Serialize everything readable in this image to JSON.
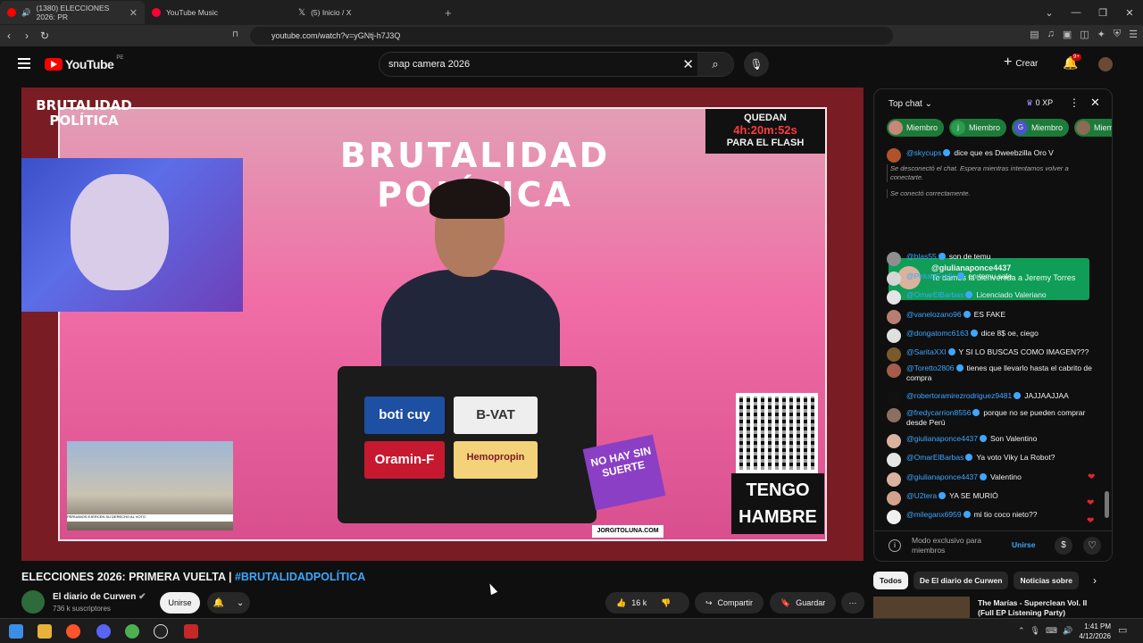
{
  "browser": {
    "tabs": [
      {
        "label": "(1380) ELECCIONES 2026: PR",
        "color": "#ff0000"
      },
      {
        "label": "YouTube Music",
        "color": "#ff0033"
      },
      {
        "label": "(5) Inicio / X",
        "color": "#ffffff"
      }
    ],
    "url": "youtube.com/watch?v=yGNtj-h7J3Q"
  },
  "header": {
    "brand": "YouTube",
    "country_code": "PE",
    "search_value": "snap camera 2026",
    "create_label": "Crear",
    "notif_badge": "9+"
  },
  "video": {
    "headline": "BRUTALIDAD POLÍTICA",
    "logo_text": "BRUTALIDAD POLÍTICA",
    "timer_top": "QUEDAN",
    "timer_value": "4h:20m:52s",
    "timer_bottom": "PARA EL FLASH",
    "stickers": [
      "boti cuy",
      "B-VAT",
      "Oramin-F",
      "Hemopropin"
    ],
    "nohay": "NO HAY SIN SUERTE",
    "tengo": "TENGO HAMBRE",
    "handle": "JORGITOLUNA.COM",
    "inset_caption": "PERUANOS EJERCEN SU DERECHO AL VOTO"
  },
  "info": {
    "title": "ELECCIONES 2026: PRIMERA VUELTA | ",
    "hashtag": "#BRUTALIDADPOLÍTICA",
    "channel": "El diario de Curwen",
    "subscribers": "736 k suscriptores",
    "join": "Unirse",
    "likes": "16 k",
    "share": "Compartir",
    "save": "Guardar"
  },
  "chat": {
    "mode": "Top chat",
    "xp": "0 XP",
    "member_label": "Miembro",
    "member_pills": [
      {
        "initial": "",
        "color": "#c8877a"
      },
      {
        "initial": "j",
        "color": "#2b9b4f"
      },
      {
        "initial": "G",
        "color": "#4a55c8"
      },
      {
        "initial": "",
        "color": "#8a6b55"
      }
    ],
    "messages": [
      {
        "user": "@skycups",
        "text": "dice que es Dweebzilla Oro V",
        "color": "#b0532d"
      },
      {
        "user": "@blas55",
        "text": "son de temu",
        "color": "#8f8f8f"
      },
      {
        "user": "@PirkaqGrafic",
        "text": "en temu sale",
        "color": "#d6d6d6"
      },
      {
        "user": "@OmarElBarbas",
        "text": "Licenciado Valeriano",
        "color": "#e5e5e5"
      },
      {
        "user": "@vanelozano96",
        "text": "ES FAKE",
        "color": "#b77e72"
      },
      {
        "user": "@dongatomc6163",
        "text": "dice 8$ oe, ciego",
        "color": "#e0e0e0"
      },
      {
        "user": "@SaritaXXI",
        "text": "Y SI LO BUSCAS COMO IMAGEN???",
        "color": "#7a5a2a"
      },
      {
        "user": "@Toretto2806",
        "text": "tienes que llevarlo hasta el cabrito de compra",
        "color": "#a65b4b"
      },
      {
        "user": "@robertoramirezrodriguez9481",
        "text": "JAJJAAJJAA",
        "color": "#111111"
      },
      {
        "user": "@fredycarrion8556",
        "text": "porque no se pueden comprar desde Perú",
        "color": "#8d6e63"
      },
      {
        "user": "@giulianaponce4437",
        "text": "Son Valentino",
        "color": "#d9b39e"
      },
      {
        "user": "@OmarElBarbas",
        "text": "Ya voto Viky La Robot?",
        "color": "#e5e5e5"
      },
      {
        "user": "@giulianaponce4437",
        "text": "Valentino",
        "color": "#d9b39e"
      },
      {
        "user": "@U2tera",
        "text": "YA SE MURIÓ",
        "color": "#d2a28c"
      },
      {
        "user": "@mileganx6959",
        "text": "mi tio coco nieto??",
        "color": "#f0f0f0"
      }
    ],
    "system_disconnect": "Se desconectó el chat. Espera mientras intentamos volver a conectarte.",
    "system_connect": "Se conectó correctamente.",
    "welcome_user": "@giulianaponce4437",
    "welcome_text": "Te damos la bienvenida a Jeremy Torres",
    "footer_text": "Modo exclusivo para miembros",
    "footer_join": "Unirse"
  },
  "chips": [
    "Todos",
    "De El diario de Curwen",
    "Noticias sobre"
  ],
  "recommendation": {
    "title": "The Marías - Superclean Vol. II (Full EP Listening Party)"
  },
  "taskbar": {
    "time": "1:41 PM",
    "date": "4/12/2026"
  }
}
